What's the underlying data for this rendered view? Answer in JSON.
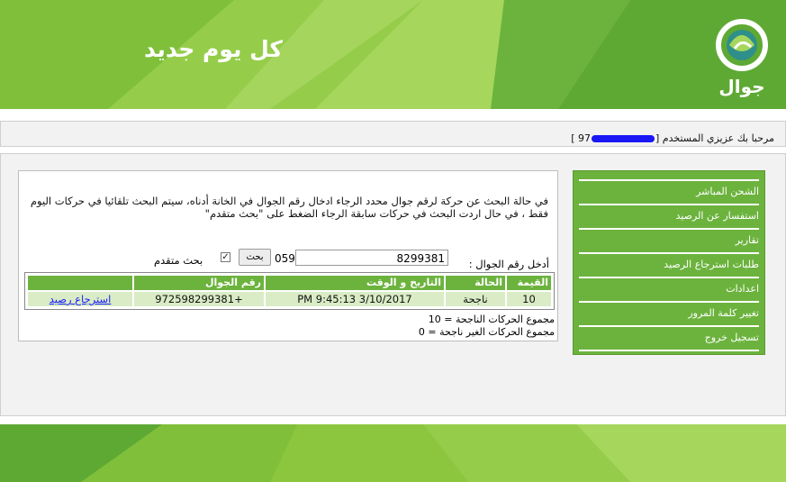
{
  "header": {
    "slogan": "كل يوم جديد",
    "logo_text": "جوال"
  },
  "welcome": {
    "text_before": "مرحبا بك عزيزي المستخدم [",
    "text_prefix": "97",
    "text_after": " ]"
  },
  "menu": {
    "items": [
      {
        "label": "الشحن المباشر"
      },
      {
        "label": "استفسار عن الرصيد"
      },
      {
        "label": "تقارير"
      },
      {
        "label": "طلبات استرجاع الرصيد"
      },
      {
        "label": "اعدادات"
      },
      {
        "label": "تغيير كلمة المرور"
      },
      {
        "label": "تسجيل خروج"
      }
    ]
  },
  "search": {
    "info_text": "في حالة البحث عن حركة لرقم جوال محدد الرجاء ادخال رقم الجوال في الخانة أدناه، سيتم البحث تلقائيا في حركات اليوم فقط ، في حال اردت البحث في حركات سابقة الرجاء الضغط على \"بحث متقدم\"",
    "phone_label": "أدخل رقم الجوال :",
    "phone_value": "8299381",
    "prefix": "059",
    "search_button": "بحث",
    "advanced_checked": true,
    "advanced_label": "بحث متقدم"
  },
  "results": {
    "columns": [
      "القيمة",
      "الحالة",
      "التاريخ و الوقت",
      "رقم الجوال",
      ""
    ],
    "rows": [
      {
        "value": "10",
        "status": "ناجحة",
        "datetime": "3/10/2017 9:45:13 PM",
        "phone": "+972598299381",
        "action": "استرجاع رصيد"
      }
    ],
    "success_total": "مجموع الحركات الناجحة = 10",
    "failed_total": "مجموع الحركات الغير ناجحة = 0"
  },
  "colors": {
    "brand_green": "#6cb33e",
    "row_green": "#d9ecc6",
    "link_blue": "#1a1aff"
  }
}
